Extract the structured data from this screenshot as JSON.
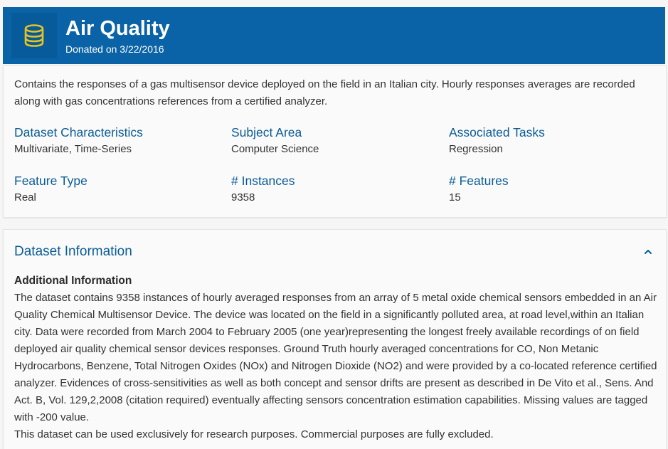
{
  "header": {
    "title": "Air Quality",
    "donated": "Donated on 3/22/2016",
    "icon": "database-icon",
    "background_color": "#0a63a6",
    "icon_color": "#e8c31e"
  },
  "summary": {
    "description": "Contains the responses of a gas multisensor device deployed on the field in an Italian city. Hourly responses averages are recorded along with gas concentrations references from a certified analyzer.",
    "fields": [
      {
        "label": "Dataset Characteristics",
        "value": "Multivariate, Time-Series"
      },
      {
        "label": "Subject Area",
        "value": "Computer Science"
      },
      {
        "label": "Associated Tasks",
        "value": "Regression"
      },
      {
        "label": "Feature Type",
        "value": "Real"
      },
      {
        "label": "# Instances",
        "value": "9358"
      },
      {
        "label": "# Features",
        "value": "15"
      }
    ]
  },
  "dataset_information": {
    "title": "Dataset Information",
    "collapse_icon": "chevron-up-icon",
    "additional_heading": "Additional Information",
    "paragraph1": "The dataset contains 9358 instances of hourly averaged responses from an array of 5 metal oxide chemical sensors embedded in an Air Quality Chemical Multisensor Device. The device was located on the field in a significantly polluted area, at road level,within an Italian city. Data were recorded from March 2004 to February 2005 (one year)representing the longest freely available recordings of on field deployed air quality chemical sensor devices responses. Ground Truth hourly averaged concentrations for CO, Non Metanic Hydrocarbons, Benzene, Total Nitrogen Oxides (NOx) and Nitrogen Dioxide (NO2)  and were provided by a co-located reference certified analyzer. Evidences of cross-sensitivities as well as both concept and sensor drifts are present as described in De Vito et al., Sens. And Act. B, Vol. 129,2,2008 (citation required) eventually affecting sensors concentration estimation capabilities. Missing values are tagged with -200 value.",
    "paragraph2": "This dataset can be used exclusively for research purposes. Commercial purposes are fully excluded."
  }
}
